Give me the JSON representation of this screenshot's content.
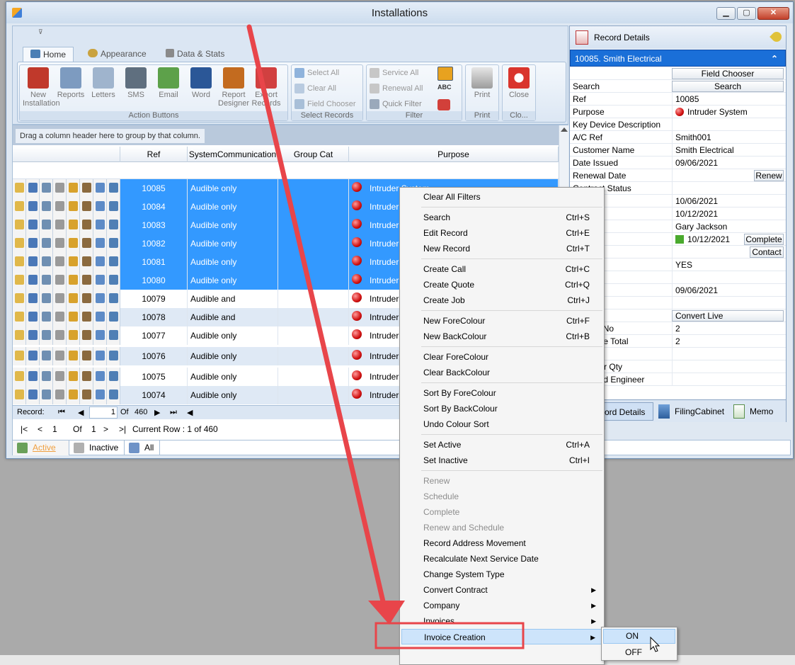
{
  "window": {
    "title": "Installations",
    "min_glyph": "▁",
    "max_glyph": "▢",
    "close_glyph": "✕"
  },
  "ribbon": {
    "qat_glyph": "⊽",
    "tabs": [
      {
        "label": "Home"
      },
      {
        "label": "Appearance"
      },
      {
        "label": "Data & Stats"
      }
    ],
    "action_buttons": [
      {
        "label": "New Installation",
        "icon": "house-icon"
      },
      {
        "label": "Reports",
        "icon": "report-magnifier-icon"
      },
      {
        "label": "Letters",
        "icon": "letters-icon"
      },
      {
        "label": "SMS",
        "icon": "sms-icon"
      },
      {
        "label": "Email",
        "icon": "email-icon"
      },
      {
        "label": "Word",
        "icon": "word-icon"
      },
      {
        "label": "Report Designer",
        "icon": "report-designer-icon"
      },
      {
        "label": "Export Records",
        "icon": "export-icon"
      }
    ],
    "group_labels": {
      "action": "Action Buttons",
      "select": "Select Records",
      "filter": "Filter",
      "print": "Print",
      "close": "Clo..."
    },
    "select_buttons": [
      {
        "label": "Select All"
      },
      {
        "label": "Clear All"
      },
      {
        "label": "Field Chooser"
      }
    ],
    "filter_buttons": [
      {
        "label": "Service All"
      },
      {
        "label": "Renewal All"
      },
      {
        "label": "Quick Filter"
      }
    ],
    "filter_icon_caption": "ABC",
    "print_label": "Print",
    "close_label": "Close"
  },
  "grid": {
    "group_hint": "Drag a column header here to group by that column.",
    "columns": [
      "Ref",
      "SystemCommunication",
      "Group Cat",
      "Purpose"
    ],
    "rows": [
      {
        "ref": "10085",
        "comm": "Audible only",
        "purpose": "Intruder System",
        "selected": true
      },
      {
        "ref": "10084",
        "comm": "Audible only",
        "purpose": "Intruder Sy",
        "selected": true
      },
      {
        "ref": "10083",
        "comm": "Audible only",
        "purpose": "Intruder Sy",
        "selected": true
      },
      {
        "ref": "10082",
        "comm": "Audible only",
        "purpose": "Intruder Sy",
        "selected": true
      },
      {
        "ref": "10081",
        "comm": "Audible only",
        "purpose": "Intruder Sy",
        "selected": true
      },
      {
        "ref": "10080",
        "comm": "Audible only",
        "purpose": "Intruder Sy",
        "selected": true
      },
      {
        "ref": "10079",
        "comm": "Audible and Communi...",
        "purpose": "Intruder Sy",
        "selected": false
      },
      {
        "ref": "10078",
        "comm": "Audible and Communi...",
        "purpose": "Intruder Sy",
        "selected": false
      },
      {
        "ref": "10077",
        "comm": "Audible only",
        "purpose": "Intruder Sy",
        "selected": false
      },
      {
        "ref": "10076",
        "comm": "Audible only",
        "purpose": "Intruder Sy",
        "selected": false
      },
      {
        "ref": "10075",
        "comm": "Audible only",
        "purpose": "Intruder Sy",
        "selected": false
      },
      {
        "ref": "10074",
        "comm": "Audible only",
        "purpose": "Intruder Sy",
        "selected": false
      }
    ],
    "nav": {
      "label": "Record:",
      "current": "1",
      "of": "Of",
      "total": "460"
    },
    "nav2": {
      "first": "|<",
      "prev": "<",
      "current": "1",
      "of": "Of",
      "total": "1",
      "next": ">",
      "last": ">|",
      "status": "Current Row : 1 of 460"
    }
  },
  "bottom_tabs": [
    {
      "label": "Active"
    },
    {
      "label": "Inactive"
    },
    {
      "label": "All"
    }
  ],
  "record_details": {
    "title": "Record Details",
    "record": "10085. Smith Electrical",
    "collapse_glyph": "⌃",
    "field_chooser": "Field Chooser",
    "rows": [
      {
        "label": "Search",
        "value": "",
        "button": "Search"
      },
      {
        "label": "Ref",
        "value": "10085"
      },
      {
        "label": "Purpose",
        "value": "Intruder System"
      },
      {
        "label": "Key Device Description",
        "value": ""
      },
      {
        "label": "A/C Ref",
        "value": "Smith001"
      },
      {
        "label": "Customer Name",
        "value": "Smith Electrical"
      },
      {
        "label": "Date Issued",
        "value": "09/06/2021"
      },
      {
        "label": "Renewal Date",
        "value": "",
        "button": "Renew"
      },
      {
        "label": "Contract Status",
        "value": ""
      },
      {
        "label": "ice",
        "value": "10/06/2021"
      },
      {
        "label": "vice",
        "value": "10/12/2021"
      },
      {
        "label": "neer",
        "value": "Gary Jackson"
      },
      {
        "label": "edule",
        "value": "10/12/2021",
        "button": "Complete"
      },
      {
        "label": "ned",
        "value": "",
        "button": "Contact"
      },
      {
        "label": "d",
        "value": "YES"
      },
      {
        "label": "atus",
        "value": ""
      },
      {
        "label": "alled",
        "value": "09/06/2021"
      },
      {
        "label": "r",
        "value": ""
      },
      {
        "label": "Live",
        "value": "",
        "button": "Convert Live"
      },
      {
        "label": "quence No",
        "value": "2"
      },
      {
        "label": "e Service Total",
        "value": "2"
      },
      {
        "label": "Duration",
        "value": ""
      },
      {
        "label": "Engineer Qty",
        "value": ""
      },
      {
        "label": "Preferred Engineer",
        "value": ""
      }
    ],
    "tabs": [
      {
        "label": "cord Details"
      },
      {
        "label": "FilingCabinet"
      },
      {
        "label": "Memo"
      }
    ]
  },
  "context_menu": {
    "items": [
      {
        "label": "Clear All Filters",
        "shortcut": "",
        "state": "enabled"
      },
      {
        "sep": true
      },
      {
        "label": "Search",
        "shortcut": "Ctrl+S",
        "state": "enabled"
      },
      {
        "label": "Edit Record",
        "shortcut": "Ctrl+E",
        "state": "enabled"
      },
      {
        "label": "New Record",
        "shortcut": "Ctrl+T",
        "state": "enabled"
      },
      {
        "sep": true
      },
      {
        "label": "Create Call",
        "shortcut": "Ctrl+C",
        "state": "enabled"
      },
      {
        "label": "Create Quote",
        "shortcut": "Ctrl+Q",
        "state": "enabled"
      },
      {
        "label": "Create Job",
        "shortcut": "Ctrl+J",
        "state": "enabled"
      },
      {
        "sep": true
      },
      {
        "label": "New ForeColour",
        "shortcut": "Ctrl+F",
        "state": "enabled"
      },
      {
        "label": "New BackColour",
        "shortcut": "Ctrl+B",
        "state": "enabled"
      },
      {
        "sep": true
      },
      {
        "label": "Clear ForeColour",
        "shortcut": "",
        "state": "enabled"
      },
      {
        "label": "Clear BackColour",
        "shortcut": "",
        "state": "enabled"
      },
      {
        "sep": true
      },
      {
        "label": "Sort By ForeColour",
        "shortcut": "",
        "state": "enabled"
      },
      {
        "label": "Sort By BackColour",
        "shortcut": "",
        "state": "enabled"
      },
      {
        "label": "Undo Colour Sort",
        "shortcut": "",
        "state": "enabled"
      },
      {
        "sep": true
      },
      {
        "label": "Set Active",
        "shortcut": "Ctrl+A",
        "state": "enabled"
      },
      {
        "label": "Set Inactive",
        "shortcut": "Ctrl+I",
        "state": "enabled"
      },
      {
        "sep": true
      },
      {
        "label": "Renew",
        "shortcut": "",
        "state": "disabled"
      },
      {
        "label": "Schedule",
        "shortcut": "",
        "state": "disabled"
      },
      {
        "label": "Complete",
        "shortcut": "",
        "state": "disabled"
      },
      {
        "label": "Renew and Schedule",
        "shortcut": "",
        "state": "disabled"
      },
      {
        "label": "Record Address Movement",
        "shortcut": "",
        "state": "enabled"
      },
      {
        "label": "Recalculate Next Service Date",
        "shortcut": "",
        "state": "enabled"
      },
      {
        "label": "Change System Type",
        "shortcut": "",
        "state": "enabled"
      },
      {
        "label": "Convert Contract",
        "shortcut": "",
        "state": "enabled",
        "submenu": true
      },
      {
        "label": "Company",
        "shortcut": "",
        "state": "enabled",
        "submenu": true
      },
      {
        "label": "Invoices",
        "shortcut": "",
        "state": "enabled",
        "submenu": true
      },
      {
        "label": "Invoice Creation",
        "shortcut": "",
        "state": "highlighted",
        "submenu": true
      }
    ],
    "submenu_glyph": "▶"
  },
  "submenu": {
    "items": [
      {
        "label": "ON"
      },
      {
        "label": "OFF"
      }
    ]
  },
  "colors": {
    "selection": "#3399ff",
    "record_header": "#1a6fd8",
    "annotation": "#e8454a"
  }
}
